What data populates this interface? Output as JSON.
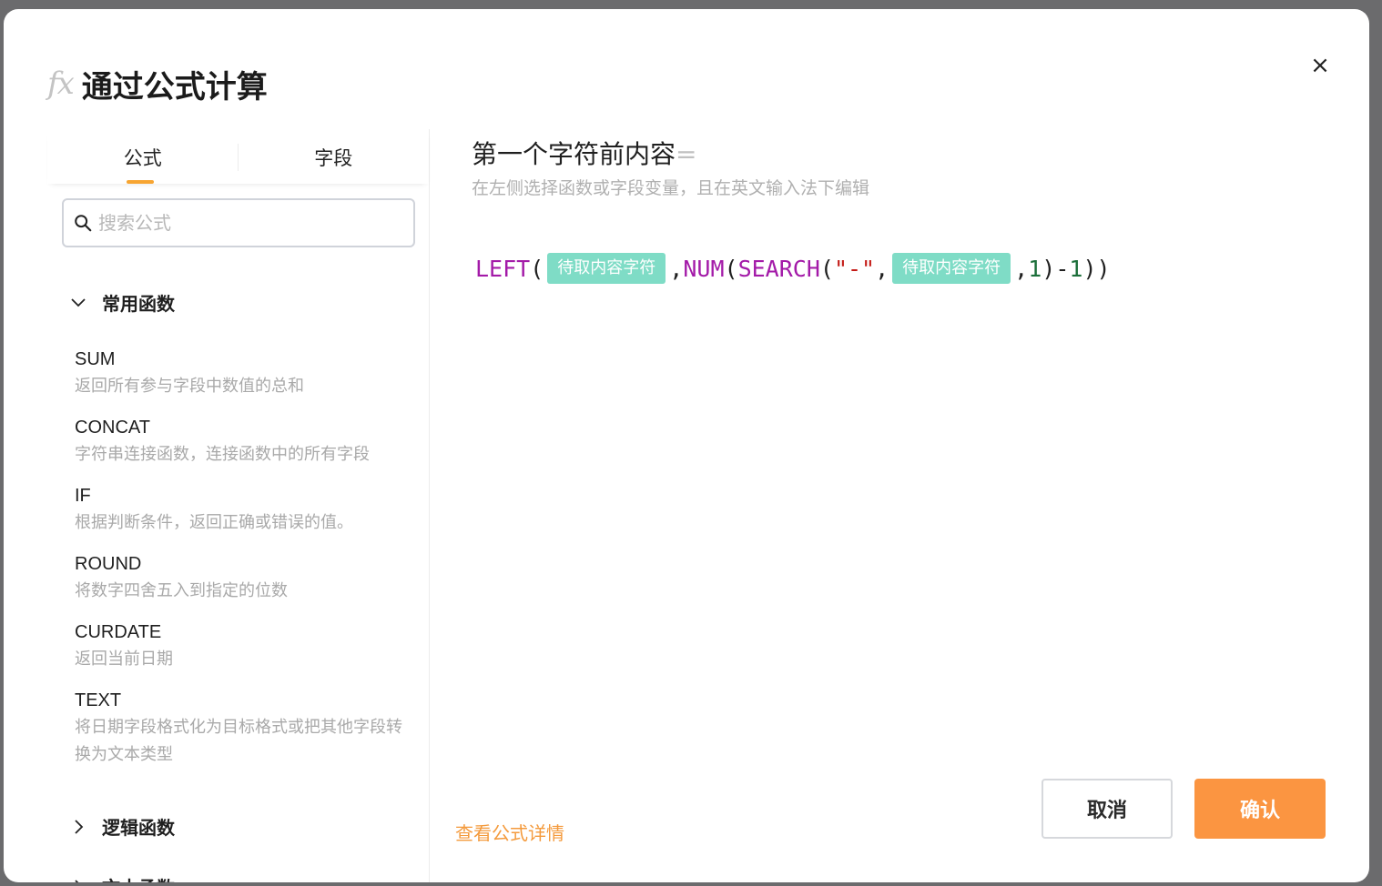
{
  "dialog": {
    "fx_glyph": "fx",
    "title": "通过公式计算",
    "close_glyph": "×"
  },
  "tabs": [
    {
      "label": "公式"
    },
    {
      "label": "字段"
    }
  ],
  "search": {
    "placeholder": "搜索公式"
  },
  "groups": {
    "common": {
      "label": "常用函数",
      "expanded": true
    },
    "logic": {
      "label": "逻辑函数",
      "expanded": false
    },
    "text": {
      "label": "文本函数",
      "expanded": false
    }
  },
  "functions": [
    {
      "name": "SUM",
      "desc": "返回所有参与字段中数值的总和"
    },
    {
      "name": "CONCAT",
      "desc": "字符串连接函数，连接函数中的所有字段"
    },
    {
      "name": "IF",
      "desc": "根据判断条件，返回正确或错误的值。"
    },
    {
      "name": "ROUND",
      "desc": "将数字四舍五入到指定的位数"
    },
    {
      "name": "CURDATE",
      "desc": "返回当前日期"
    },
    {
      "name": "TEXT",
      "desc": "将日期字段格式化为目标格式或把其他字段转换为文本类型"
    }
  ],
  "editor": {
    "formula_name": "第一个字符前内容",
    "equals": "=",
    "hint": "在左侧选择函数或字段变量，且在英文输入法下编辑",
    "tokens": [
      {
        "type": "fn",
        "text": "LEFT"
      },
      {
        "type": "punc",
        "text": "("
      },
      {
        "type": "field",
        "text": "待取内容字符"
      },
      {
        "type": "punc",
        "text": ","
      },
      {
        "type": "fn",
        "text": "NUM"
      },
      {
        "type": "punc",
        "text": "("
      },
      {
        "type": "fn",
        "text": "SEARCH"
      },
      {
        "type": "punc",
        "text": "("
      },
      {
        "type": "str",
        "text": "\"-\""
      },
      {
        "type": "punc",
        "text": ","
      },
      {
        "type": "field",
        "text": "待取内容字符"
      },
      {
        "type": "punc",
        "text": ","
      },
      {
        "type": "num",
        "text": "1"
      },
      {
        "type": "punc",
        "text": ")-"
      },
      {
        "type": "num",
        "text": "1"
      },
      {
        "type": "punc",
        "text": "))"
      }
    ]
  },
  "footer": {
    "detail_link": "查看公式详情",
    "cancel_label": "取消",
    "ok_label": "确认"
  },
  "colors": {
    "accent": "#fb9541",
    "tab_indicator": "#f7a531",
    "function_token": "#a31aa8",
    "field_chip": "#7fdcc6",
    "string_token": "#c41a16",
    "number_token": "#1c6f3a"
  }
}
